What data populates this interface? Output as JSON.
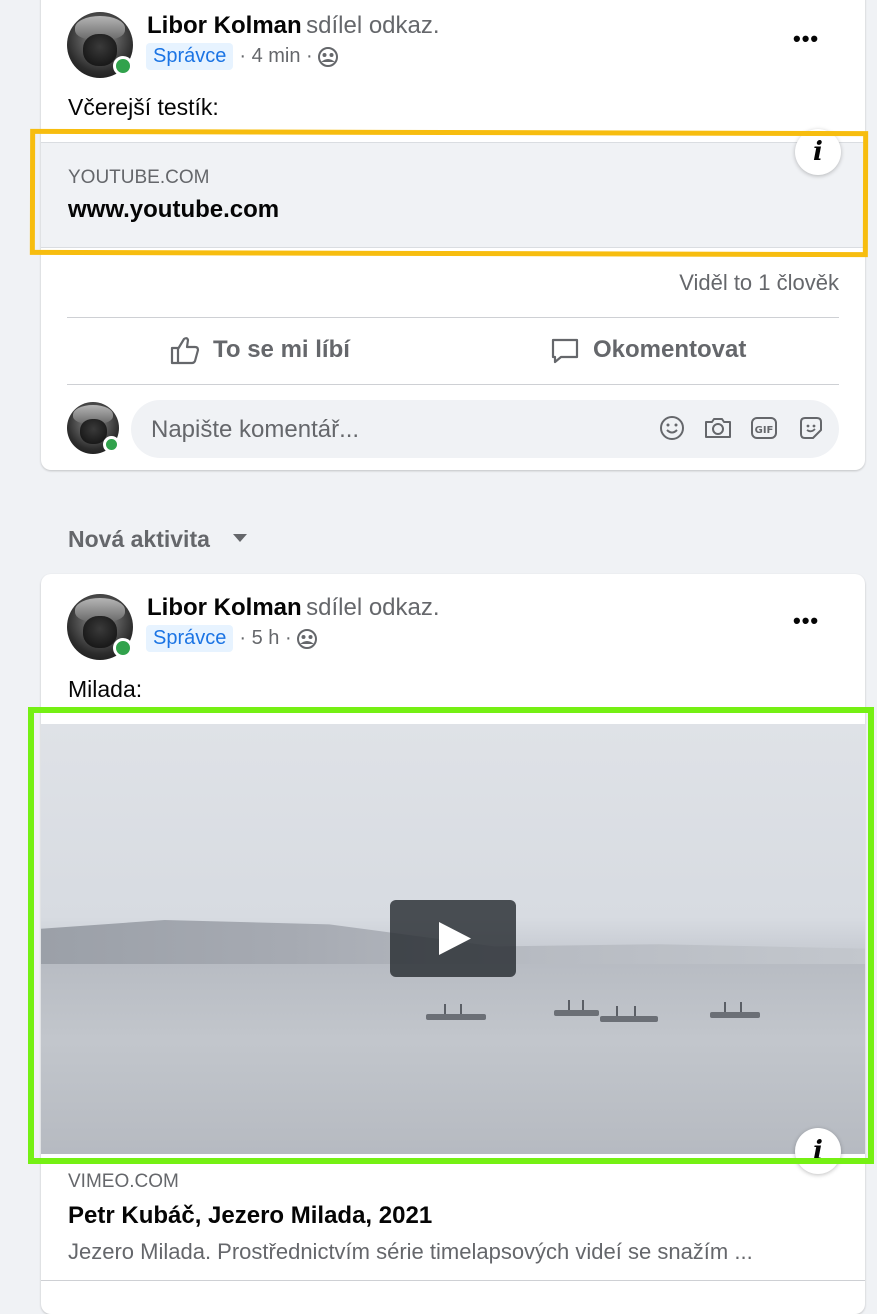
{
  "post1": {
    "author": "Libor Kolman",
    "action": "sdílel odkaz.",
    "role_badge": "Správce",
    "time": "· 4 min ·",
    "privacy_icon": "group-icon",
    "text": "Včerejší testík:",
    "link": {
      "domain": "YOUTUBE.COM",
      "title": "www.youtube.com"
    },
    "seen_by": "Viděl to 1 člověk",
    "like_label": "To se mi líbí",
    "comment_label": "Okomentovat",
    "comment_placeholder": "Napište komentář..."
  },
  "section": {
    "title": "Nová aktivita"
  },
  "post2": {
    "author": "Libor Kolman",
    "action": "sdílel odkaz.",
    "role_badge": "Správce",
    "time": "· 5 h ·",
    "privacy_icon": "group-icon",
    "text": "Milada:",
    "link": {
      "domain": "VIMEO.COM",
      "title": "Petr Kubáč, Jezero Milada, 2021",
      "description": "Jezero Milada. Prostřednictvím série timelapsových videí se snažím ..."
    }
  },
  "colors": {
    "highlight_yellow": "#f7bd0f",
    "highlight_green": "#75f013",
    "online": "#31a24c",
    "badge_bg": "#e7f3ff",
    "badge_text": "#1b74e4"
  }
}
